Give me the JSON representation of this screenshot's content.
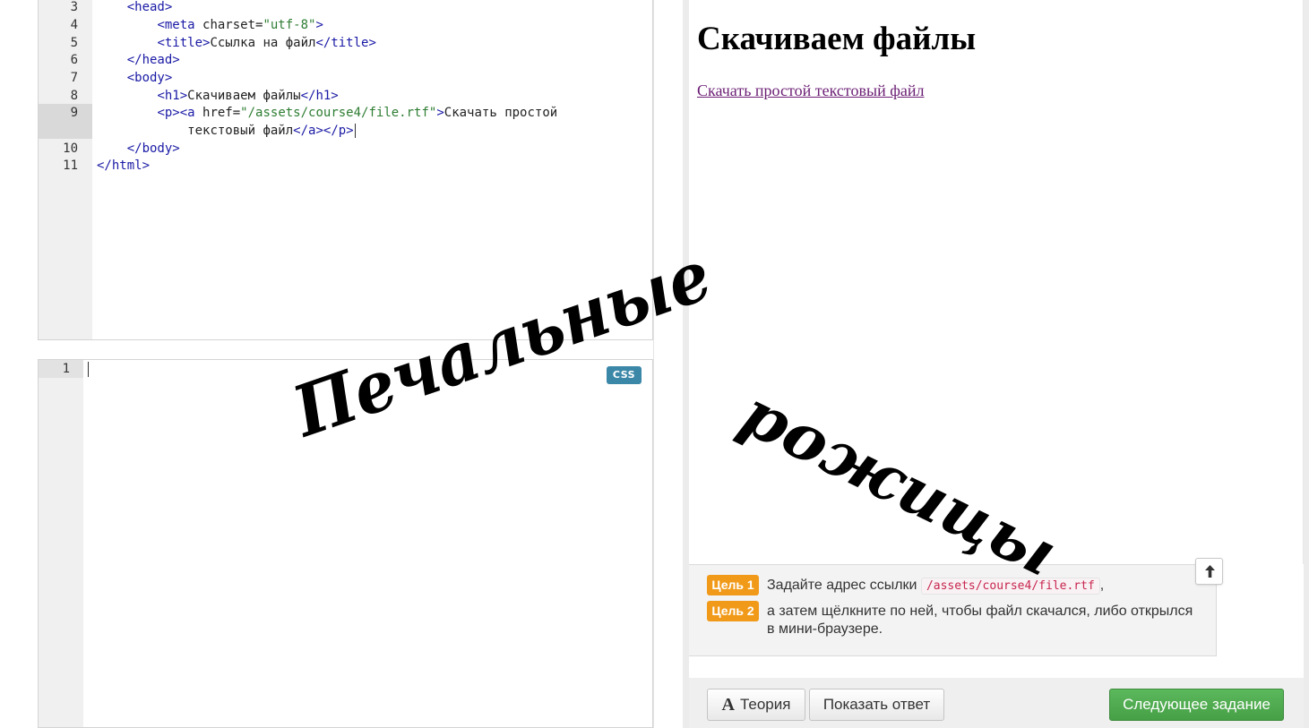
{
  "html_editor": {
    "lines": [
      {
        "num": "3"
      },
      {
        "num": "4"
      },
      {
        "num": "5"
      },
      {
        "num": "6"
      },
      {
        "num": "7"
      },
      {
        "num": "8"
      },
      {
        "num": "9"
      },
      {
        "num": "10"
      },
      {
        "num": "11"
      }
    ],
    "code": {
      "l3_tag": "<head>",
      "l4_open": "<meta",
      "l4_attr": " charset=",
      "l4_val": "\"utf-8\"",
      "l4_close": ">",
      "l5_open": "<title>",
      "l5_text": "Ссылка на файл",
      "l5_close": "</title>",
      "l6_tag": "</head>",
      "l7_tag": "<body>",
      "l8_open": "<h1>",
      "l8_text": "Скачиваем файлы",
      "l8_close": "</h1>",
      "l9_open": "<p><a",
      "l9_attr": " href=",
      "l9_val": "\"/assets/course4/file.rtf\"",
      "l9_gt": ">",
      "l9_text": "Скачать простой",
      "l9b_text": "текстовый файл",
      "l9b_close": "</a></p>",
      "l10_tag": "</body>",
      "l11_tag": "</html>"
    }
  },
  "css_editor": {
    "line_number": "1",
    "badge": "CSS"
  },
  "preview": {
    "heading": "Скачиваем файлы",
    "link": "Скачать простой текстовый файл"
  },
  "goals": [
    {
      "badge": "Цель 1",
      "text_before": "Задайте адрес ссылки",
      "code": "/assets/course4/file.rtf",
      "text_after": ","
    },
    {
      "badge": "Цель 2",
      "text": "а затем щёлкните по ней, чтобы файл скачался, либо открылся в мини-браузере."
    }
  ],
  "collapse_icon": "arrow-up-icon",
  "toolbar": {
    "theory_icon": "A",
    "theory_label": "Теория",
    "show_answer_label": "Показать ответ",
    "next_label": "Следующее задание"
  },
  "watermark": {
    "line1": "Печальные",
    "line2": "рожицы"
  },
  "colors": {
    "goal_badge": "#f19a1a",
    "next_button": "#5cb85c",
    "css_badge": "#3b87a8",
    "link": "#6b1e74",
    "tag": "#1a1aa6",
    "string": "#2e7d32"
  }
}
